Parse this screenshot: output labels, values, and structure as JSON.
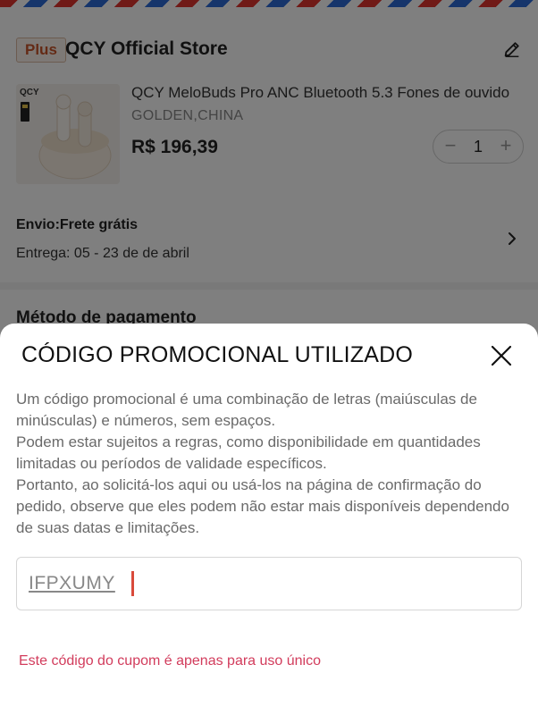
{
  "store": {
    "badge": "Plus",
    "name": "QCY Official Store"
  },
  "product": {
    "title": "QCY MeloBuds Pro ANC Bluetooth 5.3 Fones de ouvido",
    "variant": "GOLDEN,CHINA",
    "price": "R$ 196,39",
    "quantity": "1",
    "image_badge": "QCY"
  },
  "shipping": {
    "title": "Envio:Frete grátis",
    "delivery": "Entrega: 05 - 23 de de abril"
  },
  "payment": {
    "title": "Método de pagamento"
  },
  "promo_sheet": {
    "title": "CÓDIGO PROMOCIONAL UTILIZADO",
    "description_lines": [
      "Um código promocional é uma combinação de letras (maiúsculas de minúsculas) e números, sem espaços.",
      "Podem estar sujeitos a regras, como disponibilidade em quantidades limitadas ou períodos de validade específicos.",
      "Portanto, ao solicitá-los aqui ou usá-los na página de confirmação do pedido, observe que eles podem não estar mais disponíveis dependendo de suas datas e limitações."
    ],
    "code_value": "IFPXUMY",
    "error": "Este código do cupom é apenas para uso único"
  },
  "icons": {
    "edit": "edit-pencil-icon",
    "close": "close-icon",
    "chevron": "chevron-right-icon"
  },
  "colors": {
    "error": "#d23c5c",
    "caret": "#d94a3b",
    "badge_text": "#c8552a"
  }
}
